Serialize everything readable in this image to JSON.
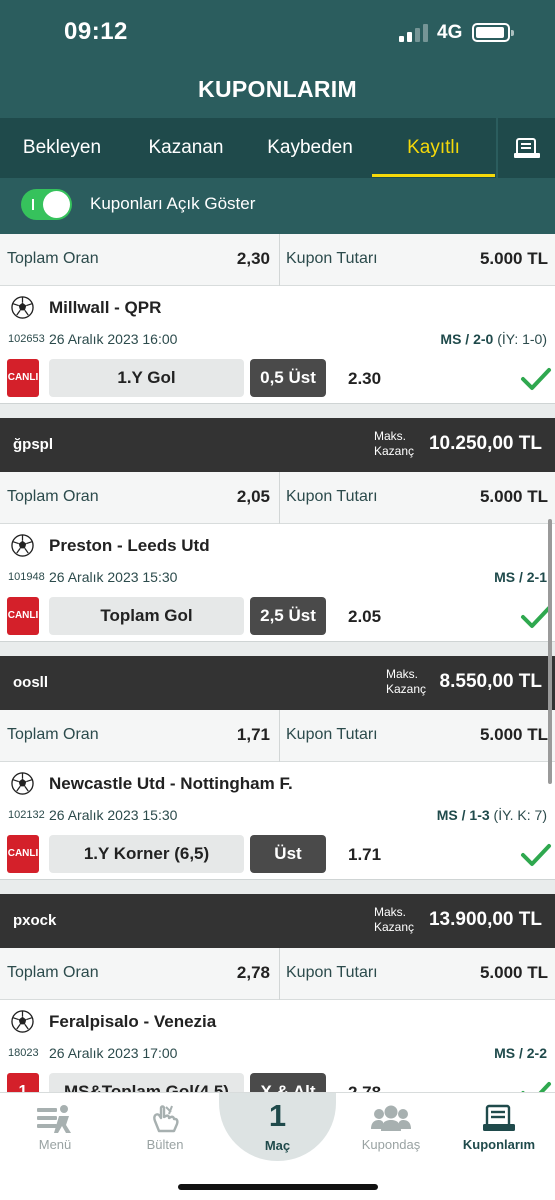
{
  "status": {
    "time": "09:12",
    "network": "4G"
  },
  "header": {
    "title": "KUPONLARIM"
  },
  "tabs": [
    {
      "label": "Bekleyen",
      "active": false
    },
    {
      "label": "Kazanan",
      "active": false
    },
    {
      "label": "Kaybeden",
      "active": false
    },
    {
      "label": "Kayıtlı",
      "active": true
    }
  ],
  "tab_icon": "receipt-icon",
  "toggle": {
    "label": "Kuponları Açık Göster",
    "on": true
  },
  "labels": {
    "total_odds": "Toplam Oran",
    "coupon_amount": "Kupon Tutarı",
    "max_win": "Maks. Kazanç",
    "live": "CANLI"
  },
  "coupons": [
    {
      "summary": {
        "total_odds": "2,30",
        "amount": "5.000 TL"
      },
      "match": {
        "name": "Millwall - QPR",
        "code": "102653",
        "date": "26 Aralık 2023 16:00",
        "result_main": "MS / 2-0",
        "result_extra": " (İY: 1-0)",
        "market": "1.Y Gol",
        "pick": "0,5 Üst",
        "odd": "2.30",
        "status": "won"
      }
    },
    {
      "name": "ğpspl",
      "max_win": "10.250,00 TL",
      "summary": {
        "total_odds": "2,05",
        "amount": "5.000 TL"
      },
      "match": {
        "name": "Preston - Leeds Utd",
        "code": "101948",
        "date": "26 Aralık 2023 15:30",
        "result_main": "MS / 2-1",
        "result_extra": "",
        "market": "Toplam Gol",
        "pick": "2,5 Üst",
        "odd": "2.05",
        "status": "won"
      }
    },
    {
      "name": "oosll",
      "max_win": "8.550,00 TL",
      "summary": {
        "total_odds": "1,71",
        "amount": "5.000 TL"
      },
      "match": {
        "name": "Newcastle Utd - Nottingham F.",
        "code": "102132",
        "date": "26 Aralık 2023 15:30",
        "result_main": "MS / 1-3",
        "result_extra": " (İY. K: 7)",
        "market": "1.Y Korner (6,5)",
        "pick": "Üst",
        "odd": "1.71",
        "status": "won"
      }
    },
    {
      "name": "pxock",
      "max_win": "13.900,00 TL",
      "summary": {
        "total_odds": "2,78",
        "amount": "5.000 TL"
      },
      "match": {
        "name": "Feralpisalo - Venezia",
        "code": "18023",
        "date": "26 Aralık 2023 17:00",
        "result_main": "MS / 2-2",
        "result_extra": "",
        "market": "MS&Toplam Gol(4,5)",
        "pick": "X & Alt",
        "odd": "2.78",
        "badge": "1",
        "status": "won"
      }
    }
  ],
  "bottom_nav": {
    "menu": "Menü",
    "bulletin": "Bülten",
    "center_number": "1",
    "center_label": "Maç",
    "kupondas": "Kupondaş",
    "kuponlarim": "Kuponlarım"
  },
  "colors": {
    "header": "#2b5d5e",
    "tabs": "#1f4a4b",
    "accent": "#f5d90a",
    "live": "#d4202a",
    "check": "#2fa84f",
    "toggle": "#36c25c"
  }
}
